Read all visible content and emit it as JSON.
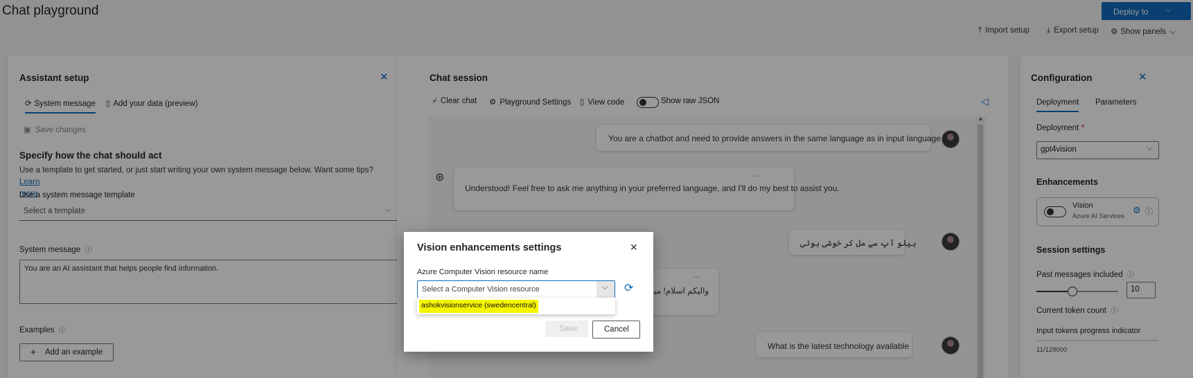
{
  "page": {
    "title": "Chat playground",
    "deploy_button": "Deploy to",
    "toolbar": {
      "import": "Import setup",
      "export": "Export setup",
      "show_panels": "Show panels"
    }
  },
  "assistant_setup": {
    "title": "Assistant setup",
    "tabs": [
      "System message",
      "Add your data (preview)"
    ],
    "save_changes": "Save changes",
    "heading": "Specify how the chat should act",
    "help_text": "Use a template to get started, or just start writing your own system message below. Want some tips?",
    "learn": "Learn",
    "more": "more",
    "template_label": "Use a system message template",
    "template_placeholder": "Select a template",
    "system_message_label": "System message",
    "system_message_value": "You are an AI assistant that helps people find information.",
    "examples_label": "Examples",
    "add_example": "Add an example"
  },
  "chat_session": {
    "title": "Chat session",
    "toolbar": {
      "clear": "Clear chat",
      "settings": "Playground Settings",
      "view_code": "View code",
      "raw_json": "Show raw JSON"
    },
    "messages": [
      {
        "role": "user",
        "text": "You are a chatbot and need to provide answers in the same language as in input language"
      },
      {
        "role": "assistant",
        "text": "Understood! Feel free to ask me anything in your preferred language, and I'll do my best to assist you.",
        "more": "..."
      },
      {
        "role": "user",
        "text": "ہیلو آپ سے مل کر خوشی ہوئی"
      },
      {
        "role": "assistant",
        "text": "والیکم اسلام! میں آپ کی",
        "more": "..."
      },
      {
        "role": "user",
        "text": "What is the latest technology available"
      }
    ]
  },
  "configuration": {
    "title": "Configuration",
    "tabs": [
      "Deployment",
      "Parameters"
    ],
    "deployment_label": "Deployment",
    "required_mark": "*",
    "deployment_value": "gpt4vision",
    "enhancements_label": "Enhancements",
    "vision": {
      "title": "Vision",
      "subtitle": "Azure AI Services"
    },
    "session_settings": "Session settings",
    "past_messages_label": "Past messages included",
    "past_messages_value": "10",
    "past_messages_fraction": 0.2,
    "token_count_label": "Current token count",
    "progress_label": "Input tokens progress indicator",
    "token_value": "11/128000"
  },
  "dialog": {
    "title": "Vision enhancements settings",
    "field_label": "Azure Computer Vision resource name",
    "placeholder": "Select a Computer Vision resource",
    "option": "ashokvisionservice (swedencentral)",
    "save": "Save",
    "cancel": "Cancel",
    "highlight_color": "#f5f500"
  }
}
